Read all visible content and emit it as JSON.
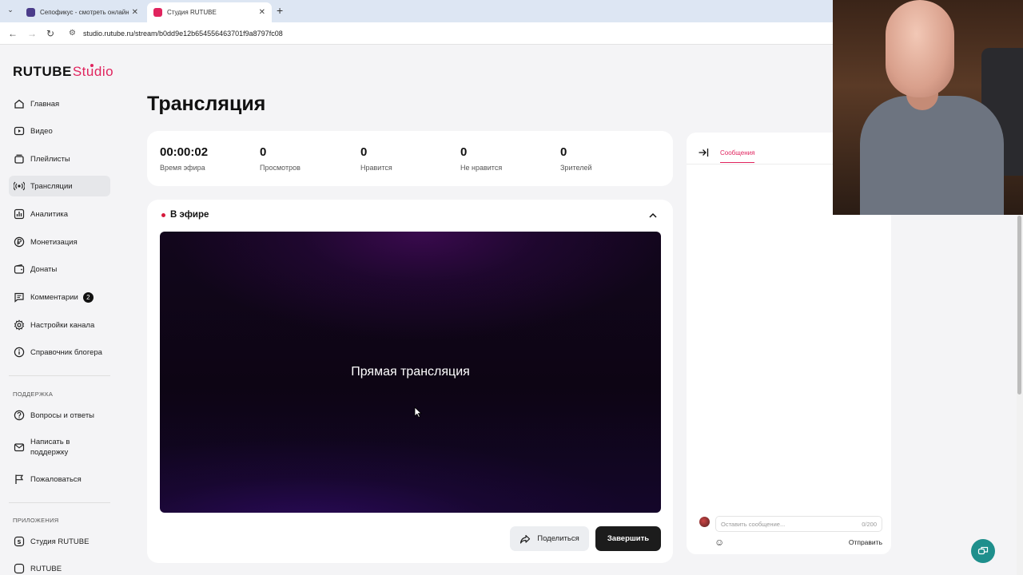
{
  "browser": {
    "tabs": [
      {
        "title": "Сепофикус - смотреть онлайн",
        "active": false
      },
      {
        "title": "Студия RUTUBE",
        "active": true
      }
    ],
    "url": "studio.rutube.ru/stream/b0dd9e12b654556463701f9a8797fc08"
  },
  "sidebar": {
    "logo_main": "RUTUBE",
    "logo_suffix": "Studio",
    "items": [
      {
        "label": "Главная",
        "icon": "home-icon"
      },
      {
        "label": "Видео",
        "icon": "video-icon"
      },
      {
        "label": "Плейлисты",
        "icon": "playlist-icon"
      },
      {
        "label": "Трансляции",
        "icon": "broadcast-icon",
        "selected": true
      },
      {
        "label": "Аналитика",
        "icon": "chart-icon"
      },
      {
        "label": "Монетизация",
        "icon": "ruble-icon"
      },
      {
        "label": "Донаты",
        "icon": "wallet-icon"
      },
      {
        "label": "Комментарии",
        "icon": "comment-icon",
        "badge": "2"
      },
      {
        "label": "Настройки канала",
        "icon": "gear-icon"
      },
      {
        "label": "Справочник блогера",
        "icon": "info-icon"
      }
    ],
    "support_label": "ПОДДЕРЖКА",
    "support_items": [
      {
        "label": "Вопросы и ответы",
        "icon": "question-icon"
      },
      {
        "label": "Написать в поддержку",
        "icon": "mail-icon"
      },
      {
        "label": "Пожаловаться",
        "icon": "flag-icon"
      }
    ],
    "apps_label": "ПРИЛОЖЕНИЯ",
    "apps_items": [
      {
        "label": "Студия RUTUBE",
        "icon": "studio-app-icon"
      },
      {
        "label": "RUTUBE",
        "icon": "rutube-app-icon"
      }
    ]
  },
  "main": {
    "title": "Трансляция",
    "stats": [
      {
        "value": "00:00:02",
        "label": "Время эфира"
      },
      {
        "value": "0",
        "label": "Просмотров"
      },
      {
        "value": "0",
        "label": "Нравится"
      },
      {
        "value": "0",
        "label": "Не нравится"
      },
      {
        "value": "0",
        "label": "Зрителей"
      }
    ],
    "live_label": "В эфире",
    "player_text": "Прямая трансляция",
    "share_label": "Поделиться",
    "end_label": "Завершить"
  },
  "chat": {
    "tab_label": "Сообщения",
    "input_placeholder": "Оставить сообщение...",
    "counter": "0/200",
    "send_label": "Отправить"
  },
  "colors": {
    "accent": "#e0245e",
    "live": "#d61a3c",
    "fab": "#1e8f8c"
  }
}
